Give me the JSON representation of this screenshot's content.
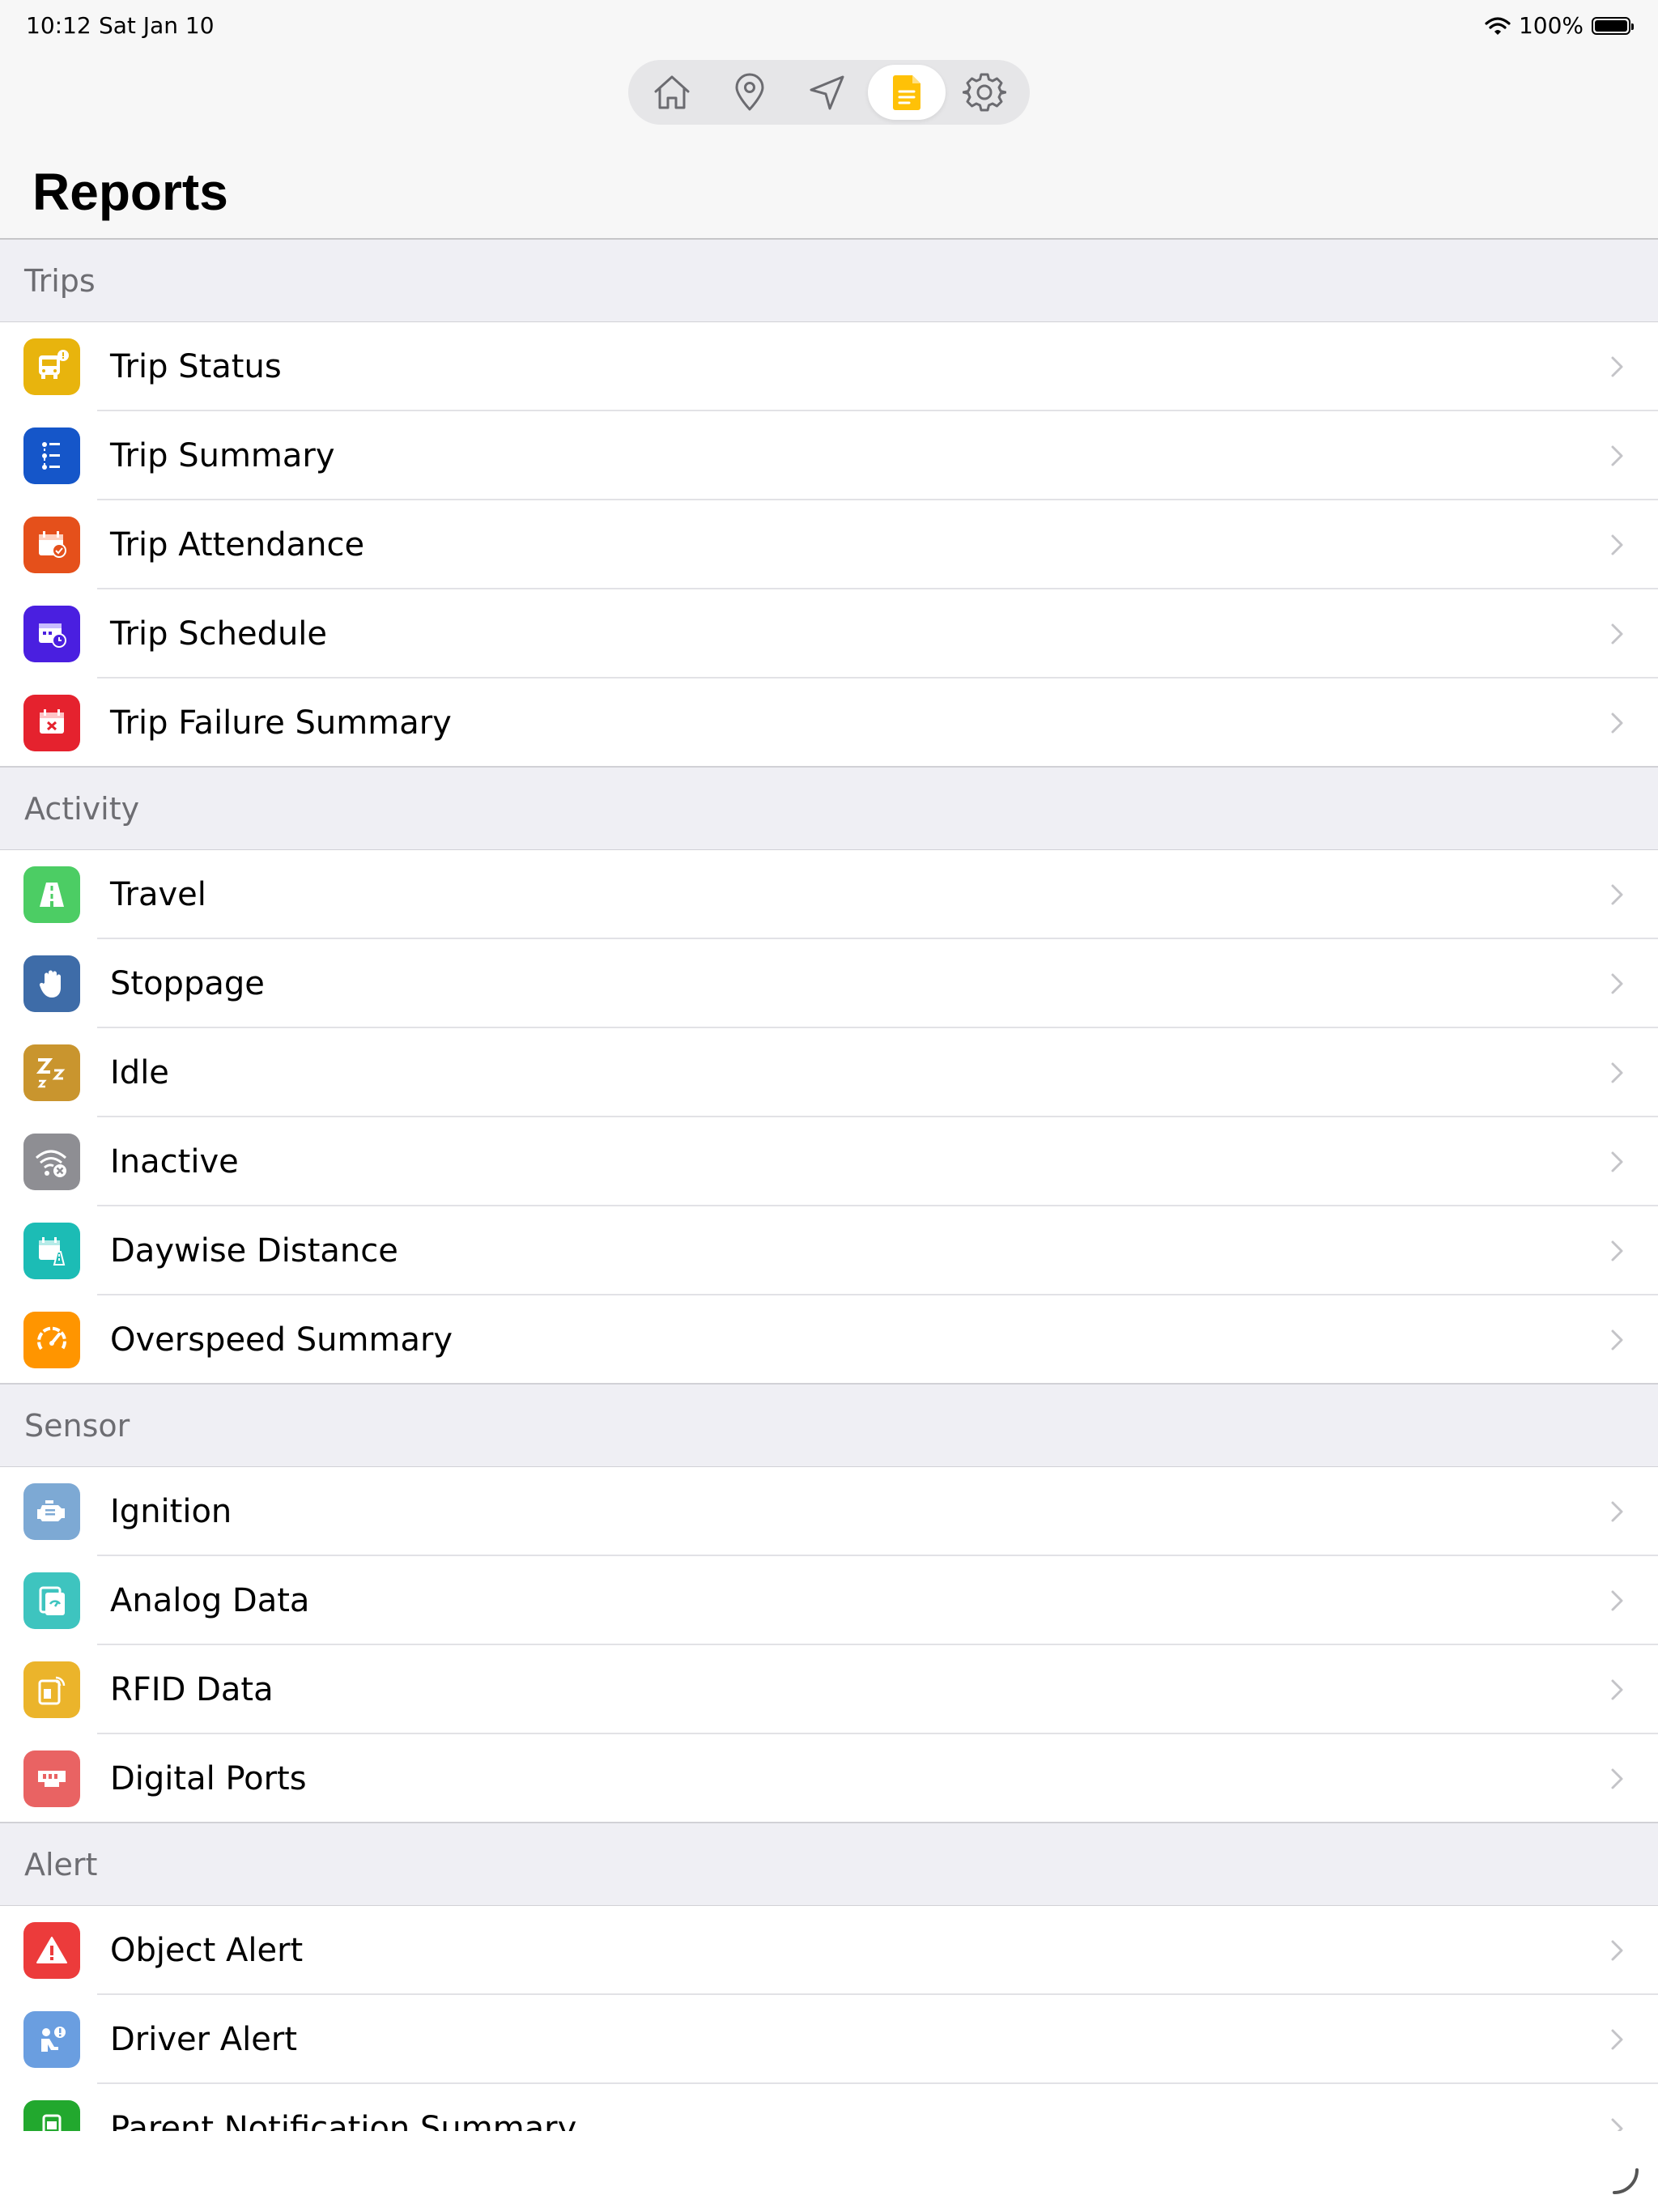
{
  "status_bar": {
    "time": "10:12",
    "date": "Sat Jan 10",
    "battery": "100%",
    "battery_level": 1.0
  },
  "tabs": [
    {
      "name": "home-icon",
      "active": false
    },
    {
      "name": "location-pin-icon",
      "active": false
    },
    {
      "name": "navigation-arrow-icon",
      "active": false
    },
    {
      "name": "reports-document-icon",
      "active": true
    },
    {
      "name": "gear-icon",
      "active": false
    }
  ],
  "page": {
    "title": "Reports"
  },
  "sections": {
    "trips": {
      "header": "Trips",
      "items": [
        {
          "label": "Trip Status",
          "icon": "bus-alert-icon",
          "color": "#e8b40d"
        },
        {
          "label": "Trip Summary",
          "icon": "route-list-icon",
          "color": "#1556c9"
        },
        {
          "label": "Trip Attendance",
          "icon": "calendar-check-icon",
          "color": "#e5501b"
        },
        {
          "label": "Trip Schedule",
          "icon": "calendar-clock-icon",
          "color": "#4a1fe0"
        },
        {
          "label": "Trip Failure Summary",
          "icon": "calendar-x-icon",
          "color": "#e5222e"
        }
      ]
    },
    "activity": {
      "header": "Activity",
      "items": [
        {
          "label": "Travel",
          "icon": "road-icon",
          "color": "#4ccd64"
        },
        {
          "label": "Stoppage",
          "icon": "hand-stop-icon",
          "color": "#3e6ca8"
        },
        {
          "label": "Idle",
          "icon": "sleep-zz-icon",
          "color": "#c9952e"
        },
        {
          "label": "Inactive",
          "icon": "signal-off-icon",
          "color": "#8e8e93"
        },
        {
          "label": "Daywise Distance",
          "icon": "calendar-road-icon",
          "color": "#1cbcb5"
        },
        {
          "label": "Overspeed Summary",
          "icon": "speedometer-icon",
          "color": "#ff9500"
        }
      ]
    },
    "sensor": {
      "header": "Sensor",
      "items": [
        {
          "label": "Ignition",
          "icon": "engine-icon",
          "color": "#7da9d4"
        },
        {
          "label": "Analog Data",
          "icon": "analog-gauge-icon",
          "color": "#3ec4bf"
        },
        {
          "label": "RFID Data",
          "icon": "rfid-card-icon",
          "color": "#ebb42b"
        },
        {
          "label": "Digital Ports",
          "icon": "digital-port-icon",
          "color": "#e96363"
        }
      ]
    },
    "alert": {
      "header": "Alert",
      "items": [
        {
          "label": "Object Alert",
          "icon": "warning-triangle-icon",
          "color": "#ec3b3b"
        },
        {
          "label": "Driver Alert",
          "icon": "driver-alert-icon",
          "color": "#6a9ee0"
        },
        {
          "label": "Parent Notification Summary",
          "icon": "phone-notification-icon",
          "color": "#22a82e"
        }
      ]
    }
  }
}
